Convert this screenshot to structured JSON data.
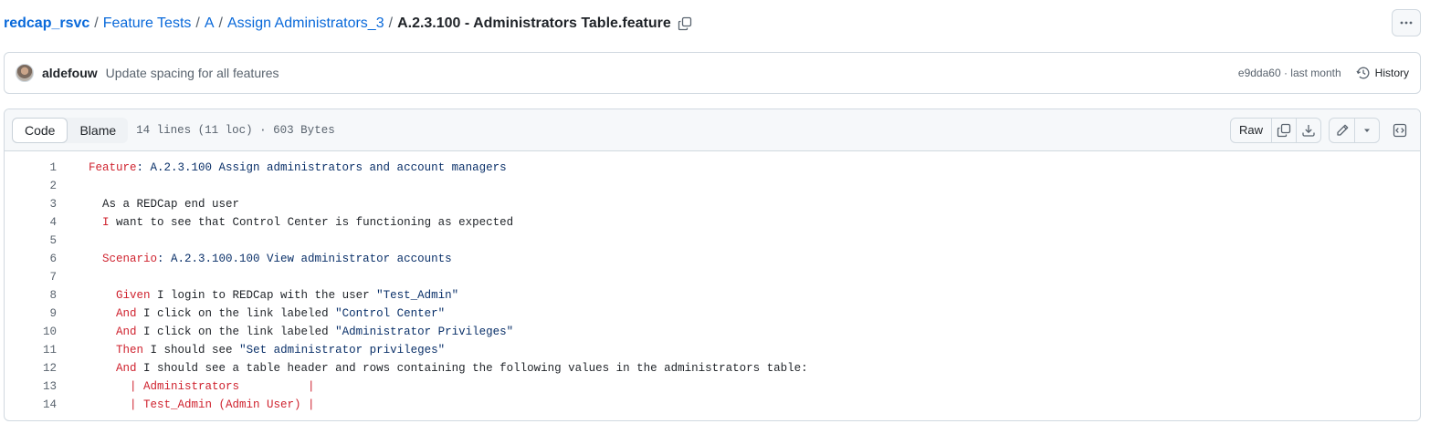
{
  "breadcrumb": {
    "repo": "redcap_rsvc",
    "sep": "/",
    "path": [
      "Feature Tests",
      "A",
      "Assign Administrators_3"
    ],
    "file": "A.2.3.100 - Administrators Table.feature"
  },
  "commit": {
    "author": "aldefouw",
    "message": "Update spacing for all features",
    "meta": "e9dda60 · last month",
    "history_label": "History"
  },
  "file_header": {
    "tabs": [
      "Code",
      "Blame"
    ],
    "meta": "14 lines (11 loc) · 603 Bytes",
    "raw_label": "Raw"
  },
  "code": {
    "lines": [
      {
        "n": "1",
        "segs": [
          {
            "c": "",
            "t": ""
          },
          {
            "c": "kw",
            "t": "Feature"
          },
          {
            "c": "str",
            "t": ": A.2.3.100 Assign administrators and account managers"
          }
        ]
      },
      {
        "n": "2",
        "segs": []
      },
      {
        "n": "3",
        "segs": [
          {
            "c": "",
            "t": "  As a REDCap end user"
          }
        ]
      },
      {
        "n": "4",
        "segs": [
          {
            "c": "",
            "t": "  "
          },
          {
            "c": "kw",
            "t": "I"
          },
          {
            "c": "",
            "t": " want to see that Control Center is functioning as expected"
          }
        ]
      },
      {
        "n": "5",
        "segs": []
      },
      {
        "n": "6",
        "segs": [
          {
            "c": "",
            "t": "  "
          },
          {
            "c": "kw",
            "t": "Scenario"
          },
          {
            "c": "str",
            "t": ": A.2.3.100.100 View administrator accounts"
          }
        ]
      },
      {
        "n": "7",
        "segs": []
      },
      {
        "n": "8",
        "segs": [
          {
            "c": "",
            "t": "    "
          },
          {
            "c": "kw",
            "t": "Given"
          },
          {
            "c": "",
            "t": " I login to REDCap with the user "
          },
          {
            "c": "str",
            "t": "\"Test_Admin\""
          }
        ]
      },
      {
        "n": "9",
        "segs": [
          {
            "c": "",
            "t": "    "
          },
          {
            "c": "kw",
            "t": "And"
          },
          {
            "c": "",
            "t": " I click on the link labeled "
          },
          {
            "c": "str",
            "t": "\"Control Center\""
          }
        ]
      },
      {
        "n": "10",
        "segs": [
          {
            "c": "",
            "t": "    "
          },
          {
            "c": "kw",
            "t": "And"
          },
          {
            "c": "",
            "t": " I click on the link labeled "
          },
          {
            "c": "str",
            "t": "\"Administrator Privileges\""
          }
        ]
      },
      {
        "n": "11",
        "segs": [
          {
            "c": "",
            "t": "    "
          },
          {
            "c": "kw",
            "t": "Then"
          },
          {
            "c": "",
            "t": " I should see "
          },
          {
            "c": "str",
            "t": "\"Set administrator privileges\""
          }
        ]
      },
      {
        "n": "12",
        "segs": [
          {
            "c": "",
            "t": "    "
          },
          {
            "c": "kw",
            "t": "And"
          },
          {
            "c": "",
            "t": " I should see a table header and rows containing the following values in the administrators table:"
          }
        ]
      },
      {
        "n": "13",
        "segs": [
          {
            "c": "",
            "t": "      "
          },
          {
            "c": "tbl",
            "t": "| Administrators          |"
          }
        ]
      },
      {
        "n": "14",
        "segs": [
          {
            "c": "",
            "t": "      "
          },
          {
            "c": "tbl",
            "t": "| Test_Admin (Admin User) |"
          }
        ]
      }
    ]
  },
  "icons": {
    "copy": "copy-icon",
    "more": "kebab-horizontal-icon",
    "history": "history-icon",
    "download": "download-icon",
    "edit": "pencil-icon",
    "dropdown": "triangle-down-icon",
    "symbols": "code-square-icon"
  },
  "colors": {
    "link": "#0969da",
    "keyword": "#cf222e",
    "string": "#0a3069",
    "border": "#d1d9e0",
    "header_bg": "#f6f8fa"
  }
}
